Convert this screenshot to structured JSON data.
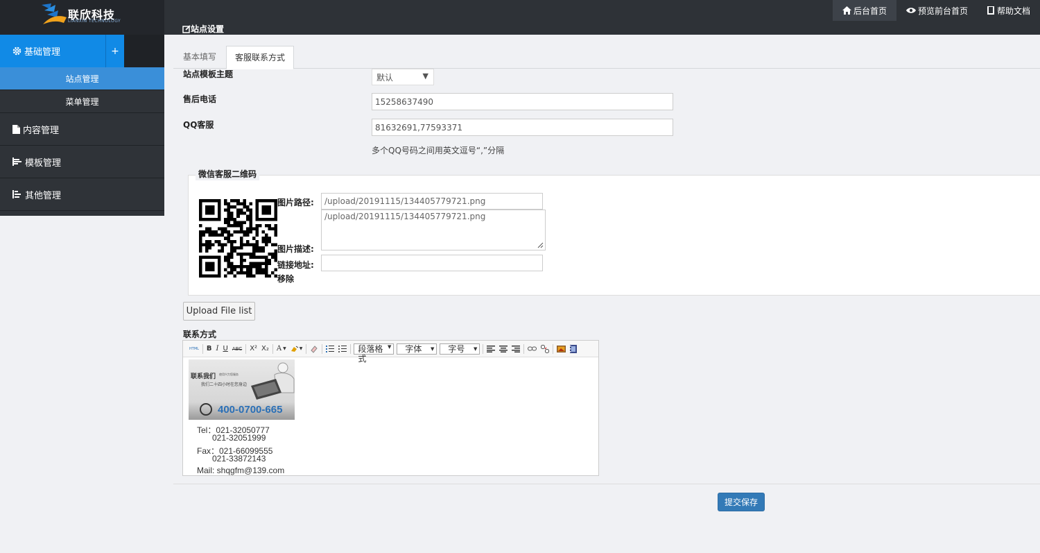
{
  "brand": {
    "name_cn": "联欣科技",
    "name_en": "LIANXIN TECHNOLOGY"
  },
  "topnav": [
    {
      "label": "后台首页",
      "icon": "home-icon"
    },
    {
      "label": "预览前台首页",
      "icon": "eye-icon"
    },
    {
      "label": "帮助文档",
      "icon": "book-icon"
    }
  ],
  "page_title": "站点设置",
  "sidebar": {
    "groups": [
      {
        "label": "基础管理",
        "icon": "gear-icon",
        "expand": "+",
        "items": [
          "站点管理",
          "菜单管理"
        ]
      },
      {
        "label": "内容管理",
        "icon": "file-icon"
      },
      {
        "label": "模板管理",
        "icon": "tree-icon"
      },
      {
        "label": "其他管理",
        "icon": "align-icon"
      }
    ]
  },
  "tabs": [
    {
      "label": "基本填写"
    },
    {
      "label": "客服联系方式"
    }
  ],
  "form": {
    "template_label": "站点模板主题",
    "template_value": "默认",
    "phone_label": "售后电话",
    "phone_value": "15258637490",
    "qq_label": "QQ客服",
    "qq_value": "81632691,77593371",
    "qq_hint": "多个QQ号码之间用英文逗号“,”分隔"
  },
  "wechat": {
    "legend": "微信客服二维码",
    "path_label": "图片路径:",
    "path_value": "/upload/20191115/134405779721.png",
    "desc_label": "图片描述:",
    "desc_value": "/upload/20191115/134405779721.png",
    "link_label": "链接地址:",
    "link_value": "",
    "remove_label": "移除"
  },
  "upload_button": "Upload File list",
  "editor": {
    "label": "联系方式",
    "toolbar": {
      "html": "HTML",
      "bold": "B",
      "italic": "I",
      "underline": "U",
      "strike": "ABC",
      "sup": "X²",
      "sub": "X₂",
      "fontcolor": "A",
      "paragraph": "段落格式",
      "font": "字体",
      "size": "字号"
    },
    "banner": {
      "title": "联系我们",
      "slogan": "使用兴力您服务",
      "service": "我们二十四小时在您身边",
      "hotline": "400-0700-665"
    },
    "lines": {
      "tel": "Tel：021-32050777",
      "tel2": "021-32051999",
      "fax": "Fax：021-66099555",
      "fax2": "021-33872143",
      "mail": "Mail: shqgfm@139.com"
    }
  },
  "save_button": "提交保存"
}
